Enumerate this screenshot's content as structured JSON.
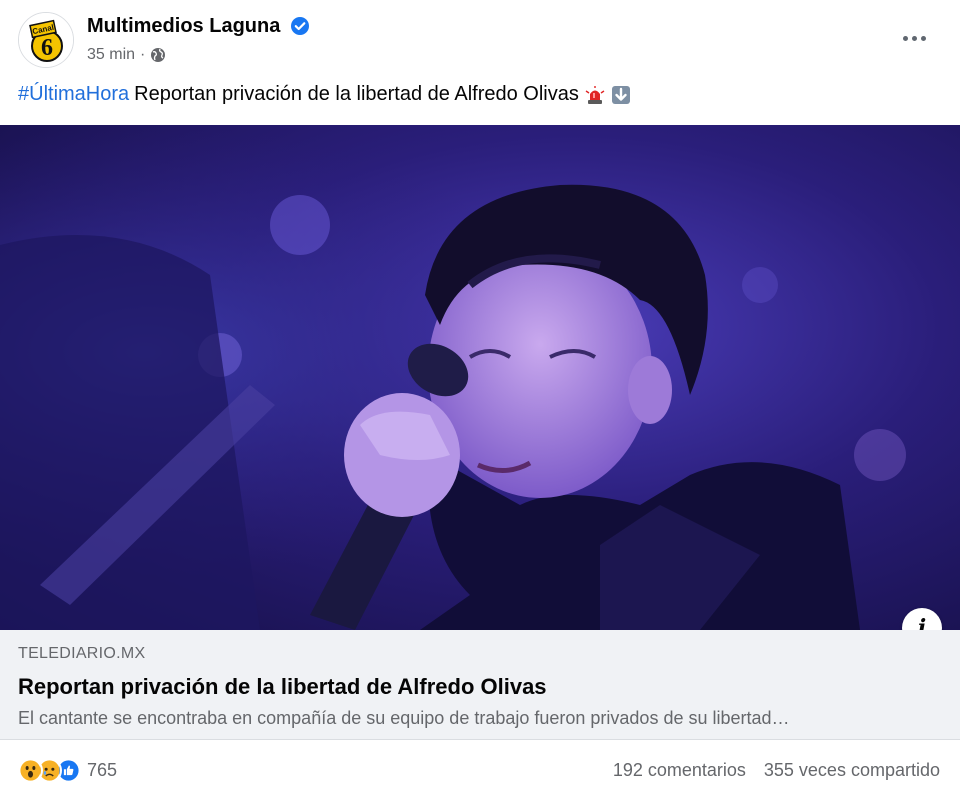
{
  "post": {
    "author": "Multimedios Laguna",
    "timestamp": "35 min",
    "separator": "·",
    "privacy_icon": "globe-icon",
    "verified_icon": "verified-badge-icon",
    "more_icon": "more-options-icon",
    "avatar_text_top": "Canal",
    "avatar_text_number": "6",
    "caption_hashtag": "#ÚltimaHora",
    "caption_text": "Reportan privación de la libertad de Alfredo Olivas",
    "caption_emojis": [
      "police-light-icon",
      "down-arrow-icon"
    ]
  },
  "link_preview": {
    "domain": "TELEDIARIO.MX",
    "title": "Reportan privación de la libertad de Alfredo Olivas",
    "description": "El cantante se encontraba en compañía de su equipo de trabajo fueron privados de su libertad…",
    "info_label": "i"
  },
  "engagement": {
    "reactions": [
      "wow-reaction-icon",
      "sad-reaction-icon",
      "like-reaction-icon"
    ],
    "reaction_count": "765",
    "comments": "192 comentarios",
    "shares": "355 veces compartido"
  },
  "colors": {
    "link_blue": "#216fdb",
    "verified_blue": "#1877f2",
    "secondary_text": "#65676b",
    "preview_bg": "#f0f2f5",
    "avatar_yellow": "#f5c400"
  }
}
